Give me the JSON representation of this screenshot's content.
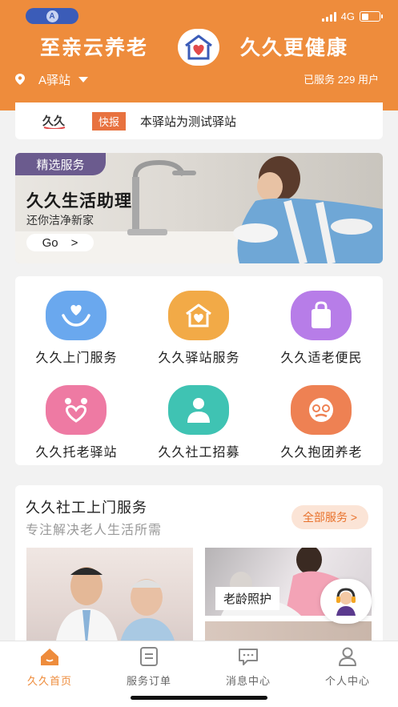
{
  "status_bar": {
    "network": "4G",
    "signal_bars": 4,
    "battery_level": 0.4
  },
  "header": {
    "slogan_left": "至亲云养老",
    "slogan_right": "久久更健康",
    "location": "A驿站",
    "served_text": "已服务 229 用户",
    "accent_color": "#ee8c3c"
  },
  "news": {
    "tag": "快报",
    "text": "本驿站为测试驿站",
    "logo_text": "久久"
  },
  "banner": {
    "tag": "精选服务",
    "title": "久久生活助理",
    "subtitle": "还你洁净新家",
    "go_label": "Go",
    "go_arrow": ">"
  },
  "services": [
    {
      "label": "久久上门服务",
      "icon": "hand-heart-icon",
      "color": "#6aa8ee"
    },
    {
      "label": "久久驿站服务",
      "icon": "house-heart-icon",
      "color": "#f2aa47"
    },
    {
      "label": "久久适老便民",
      "icon": "shopping-bag-icon",
      "color": "#b77de8"
    },
    {
      "label": "久久托老驿站",
      "icon": "couple-heart-icon",
      "color": "#ee7aa3"
    },
    {
      "label": "久久社工招募",
      "icon": "social-worker-icon",
      "color": "#3fc3b3"
    },
    {
      "label": "久久抱团养老",
      "icon": "elder-face-icon",
      "color": "#ee8153"
    }
  ],
  "section": {
    "title": "久久社工上门服务",
    "subtitle": "专注解决老人生活所需",
    "all_button": "全部服务 >",
    "card_label": "老龄照护"
  },
  "tabs": [
    {
      "label": "久久首页",
      "icon": "home-icon",
      "active": true
    },
    {
      "label": "服务订单",
      "icon": "order-icon",
      "active": false
    },
    {
      "label": "消息中心",
      "icon": "message-icon",
      "active": false
    },
    {
      "label": "个人中心",
      "icon": "profile-icon",
      "active": false
    }
  ]
}
